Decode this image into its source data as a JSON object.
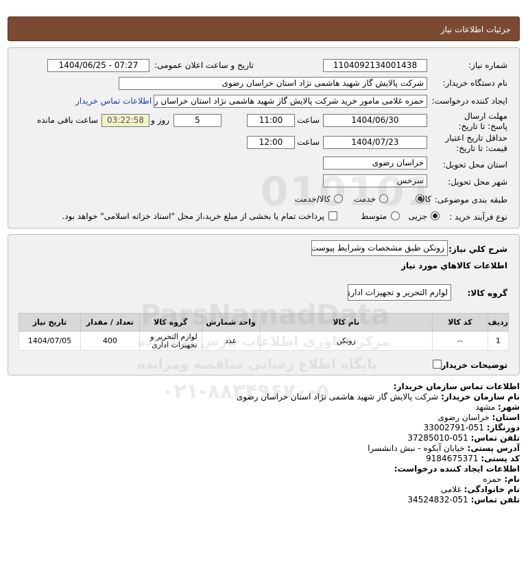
{
  "header": {
    "title": "جزئیات اطلاعات نیاز"
  },
  "form": {
    "need_number_label": "شماره نیاز:",
    "need_number": "1104092134001438",
    "announce_label": "تاریخ و ساعت اعلان عمومی:",
    "announce_value": "1404/06/25 - 07:27",
    "buyer_org_label": "نام دستگاه خریدار:",
    "buyer_org": "شرکت پالایش گاز شهید هاشمی نژاد   استان خراسان رضوی",
    "creator_label": "ایجاد کننده درخواست:",
    "creator": "حمزه غلامی مامور خرید شرکت پالایش گاز شهید هاشمی نژاد   استان خراسان رضوی",
    "contact_link": "اطلاعات تماس خریدار",
    "deadline_label": "مهلت ارسال پاسخ: تا تاریخ:",
    "deadline_date": "1404/06/30",
    "time_label": "ساعت",
    "deadline_time": "11:00",
    "days_value": "5",
    "days_label": "روز و",
    "timer_value": "03:22:58",
    "remaining_label": "ساعت باقی مانده",
    "validity_label": "حداقل تاریخ اعتبار قیمت: تا تاریخ:",
    "validity_date": "1404/07/23",
    "validity_time": "12:00",
    "province_label": "استان محل تحویل:",
    "province": "خراسان رضوی",
    "city_label": "شهر محل تحویل:",
    "city": "سرخس",
    "category_label": "طبقه بندی موضوعی:",
    "category_options": [
      "کالا",
      "خدمت",
      "کالا/خدمت"
    ],
    "category_selected": "کالا",
    "process_label": "نوع فرآیند خرید :",
    "process_options": [
      "جزیی",
      "متوسط"
    ],
    "process_selected": "جزیی",
    "payment_note": "پرداخت تمام یا بخشی از مبلغ خرید،از محل \"اسناد خزانه اسلامی\" خواهد بود."
  },
  "needs": {
    "summary_label": "شرح کلي نياز:",
    "summary": "زونکن طبق مشخصات وشرایط پیوست",
    "goods_info_title": "اطلاعات کالاهاي مورد نياز",
    "group_label": "گروه کالا:",
    "group_value": "لوازم التحرير و تجهيزات اداری",
    "table": {
      "headers": [
        "ردیف",
        "کد کالا",
        "نام کالا",
        "واحد شمارش",
        "گروه کالا",
        "تعداد / مقدار",
        "تاریخ نیاز"
      ],
      "rows": [
        [
          "1",
          "--",
          "زونکن",
          "عدد",
          "لوازم التحریر و تجهیزات اداری",
          "400",
          "1404/07/05"
        ]
      ]
    },
    "buyer_notes_label": "توضیحات خریدار:"
  },
  "contact": {
    "title": "اطلاعات تماس سازمان خریدار:",
    "org_label": "نام سازمان خریدار:",
    "org": "شرکت پالایش گاز شهید هاشمی نژاد استان خراسان رضوی",
    "city_label": "شهر:",
    "city": "مشهد",
    "province_label": "استان:",
    "province": "خراسان رضوی",
    "fax_label": "دورنگار:",
    "fax": "051-33002791",
    "phone_label": "تلفن تماس:",
    "phone": "051-37285010",
    "address_label": "آدرس پستی:",
    "address": "خیابان آبکوه - نبش دانشسرا",
    "postal_label": "کد پستی:",
    "postal": "9184675371",
    "creator_title": "اطلاعات ایجاد کننده درخواست:",
    "name_label": "نام:",
    "name": "حمزه",
    "family_label": "نام خانوادگی:",
    "family": "غلامی",
    "creator_phone_label": "تلفن تماس:",
    "creator_phone": "051-34524832"
  },
  "watermark": {
    "line1": "ParsNamadData",
    "line2": "مرکز فناوری اطلاعات پارس نماد داده",
    "line3": "پایگاه اطلاع رسانی مناقصه ومزایده",
    "line4": "۰۲۱-۸۸۳۴۹۶۷۰-۵",
    "digits": "010101"
  },
  "colors": {
    "header_bg": "#7a4a32",
    "panel_bg": "#f1f1f1",
    "link": "#1a3fa8",
    "timer_bg": "#f5f1c8"
  }
}
